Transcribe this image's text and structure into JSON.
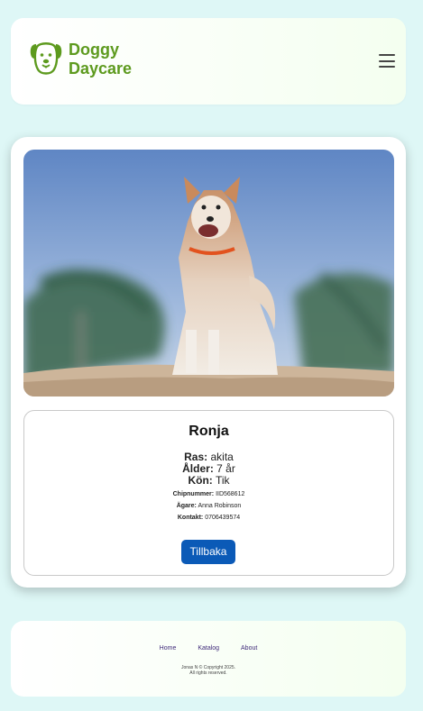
{
  "header": {
    "brand_line1": "Doggy",
    "brand_line2": "Daycare",
    "logo_icon": "dog-face-icon",
    "menu_icon": "hamburger-menu-icon",
    "brand_color": "#5d9a1e"
  },
  "dog": {
    "photo": "akita dog standing on sand",
    "name": "Ronja",
    "breed_label": "Ras:",
    "breed": "akita",
    "age_label": "Ålder:",
    "age": "7 år",
    "sex_label": "Kön:",
    "sex": "Tik",
    "chip_label": "Chipnummer:",
    "chip": "IID568612",
    "owner_label": "Ägare:",
    "owner": "Anna Robinson",
    "contact_label": "Kontakt:",
    "contact": "0706439574"
  },
  "actions": {
    "back_label": "Tillbaka",
    "back_color": "#0b5ab7"
  },
  "footer": {
    "links": [
      "Home",
      "Katalog",
      "About"
    ],
    "copyright_line1": "Jonas N © Copyright 2025.",
    "copyright_line2": "All rights reserved."
  }
}
